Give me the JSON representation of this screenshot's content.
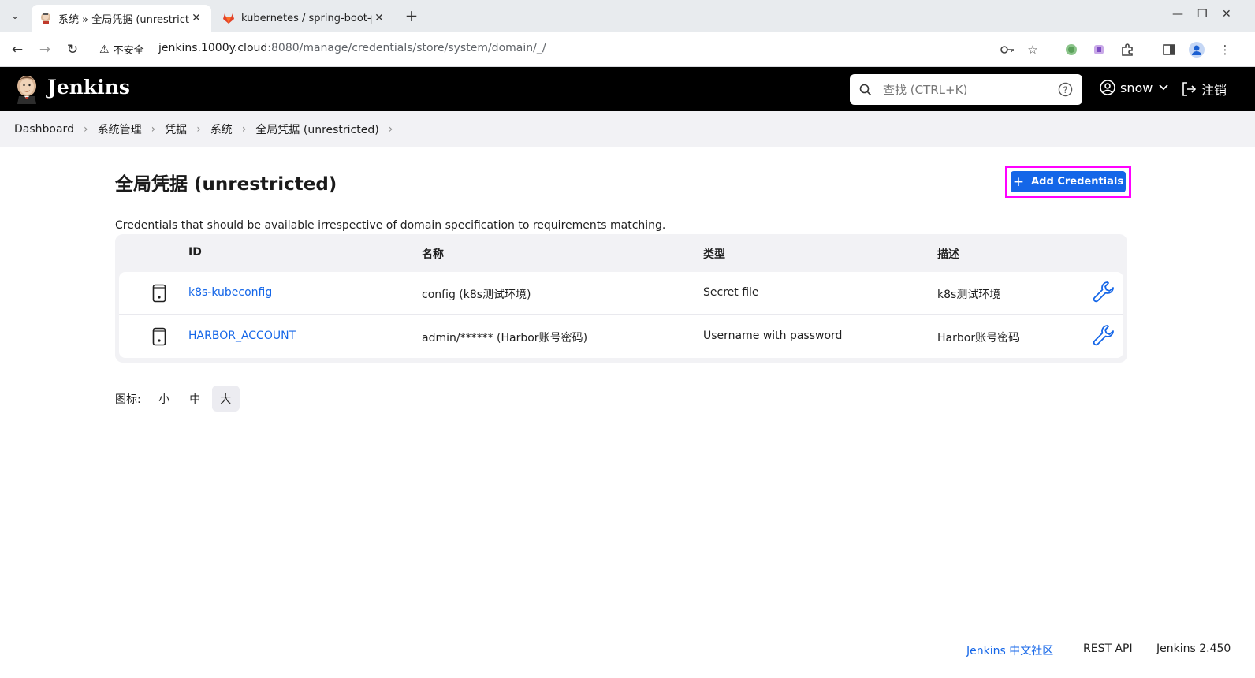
{
  "browser": {
    "tabs": [
      {
        "title": "系统 » 全局凭据 (unrestricted",
        "active": true,
        "favicon": "jenkins-favicon"
      },
      {
        "title": "kubernetes / spring-boot-p",
        "active": false,
        "favicon": "gitlab-favicon"
      }
    ],
    "security_label": "不安全",
    "url_host": "jenkins.1000y.cloud",
    "url_path": ":8080/manage/credentials/store/system/domain/_/"
  },
  "header": {
    "app_title": "Jenkins",
    "search_placeholder": "查找 (CTRL+K)",
    "user_name": "snow",
    "logout_label": "注销"
  },
  "breadcrumb": [
    "Dashboard",
    "系统管理",
    "凭据",
    "系统",
    "全局凭据 (unrestricted)"
  ],
  "main": {
    "title": "全局凭据 (unrestricted)",
    "add_button_label": "Add Credentials",
    "description": "Credentials that should be available irrespective of domain specification to requirements matching.",
    "table": {
      "headers": {
        "id": "ID",
        "name": "名称",
        "type": "类型",
        "desc": "描述"
      },
      "rows": [
        {
          "id": "k8s-kubeconfig",
          "name": "config (k8s测试环境)",
          "type": "Secret file",
          "desc": "k8s测试环境"
        },
        {
          "id": "HARBOR_ACCOUNT",
          "name": "admin/****** (Harbor账号密码)",
          "type": "Username with password",
          "desc": "Harbor账号密码"
        }
      ]
    },
    "icon_size": {
      "label": "图标:",
      "options": [
        "小",
        "中",
        "大"
      ],
      "selected": "大"
    }
  },
  "footer": {
    "community": "Jenkins 中文社区",
    "rest_api": "REST API",
    "version": "Jenkins 2.450"
  },
  "colors": {
    "accent": "#1466e8",
    "highlight": "#ff00ff",
    "header_bg": "#000000"
  }
}
